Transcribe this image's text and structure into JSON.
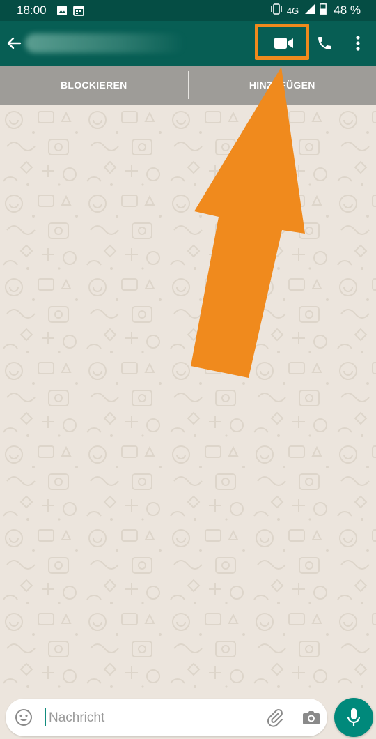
{
  "status_bar": {
    "time": "18:00",
    "left_icons": [
      "image-icon",
      "calendar-icon"
    ],
    "network": "4G",
    "battery_percent": "48 %",
    "right_icons": [
      "vibrate-icon",
      "signal-icon",
      "battery-icon"
    ]
  },
  "app_bar": {
    "contact_name": "",
    "icons": [
      "back-arrow-icon",
      "video-call-icon",
      "voice-call-icon",
      "more-vert-icon"
    ],
    "background_color": "#075e54"
  },
  "actions": {
    "block_label": "BLOCKIEREN",
    "add_label": "HINZUFÜGEN"
  },
  "annotation": {
    "highlight_target": "video-call-button",
    "color": "#f08a1d"
  },
  "composer": {
    "placeholder": "Nachricht",
    "value": "",
    "icons": [
      "emoji-icon",
      "attach-icon",
      "camera-icon",
      "mic-icon"
    ],
    "send_button_color": "#00897b"
  }
}
